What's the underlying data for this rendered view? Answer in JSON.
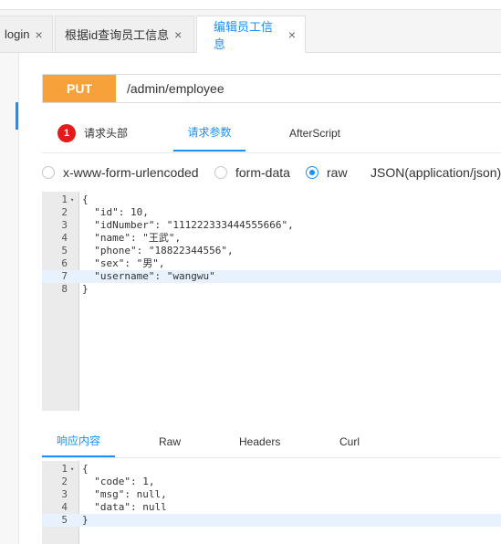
{
  "tabs": [
    {
      "label": "login",
      "close": "×"
    },
    {
      "label": "根据id查询员工信息",
      "close": "×"
    },
    {
      "label": "编辑员工信息",
      "close": "×"
    }
  ],
  "request": {
    "method": "PUT",
    "url": "/admin/employee"
  },
  "subtabs": {
    "headers_badge": "1",
    "headers": "请求头部",
    "params": "请求参数",
    "afterscript": "AfterScript"
  },
  "body_types": [
    {
      "label": "x-www-form-urlencoded",
      "selected": false
    },
    {
      "label": "form-data",
      "selected": false
    },
    {
      "label": "raw",
      "selected": true
    }
  ],
  "raw_type": "JSON(application/json)",
  "request_body": {
    "line_numbers": [
      "1",
      "2",
      "3",
      "4",
      "5",
      "6",
      "7",
      "8"
    ],
    "lines": [
      "{",
      "  \"id\": 10,",
      "  \"idNumber\": \"111222333444555666\",",
      "  \"name\": \"王武\",",
      "  \"phone\": \"18822344556\",",
      "  \"sex\": \"男\",",
      "  \"username\": \"wangwu\"",
      "}"
    ]
  },
  "response_tabs": {
    "content": "响应内容",
    "raw": "Raw",
    "headers": "Headers",
    "curl": "Curl"
  },
  "response_body": {
    "line_numbers": [
      "1",
      "2",
      "3",
      "4",
      "5"
    ],
    "lines": [
      "{",
      "  \"code\": 1,",
      "  \"msg\": null,",
      "  \"data\": null",
      "}"
    ]
  },
  "colors": {
    "accent": "#1890ff",
    "method_bg": "#f7a13a",
    "badge": "#e41b1b"
  }
}
